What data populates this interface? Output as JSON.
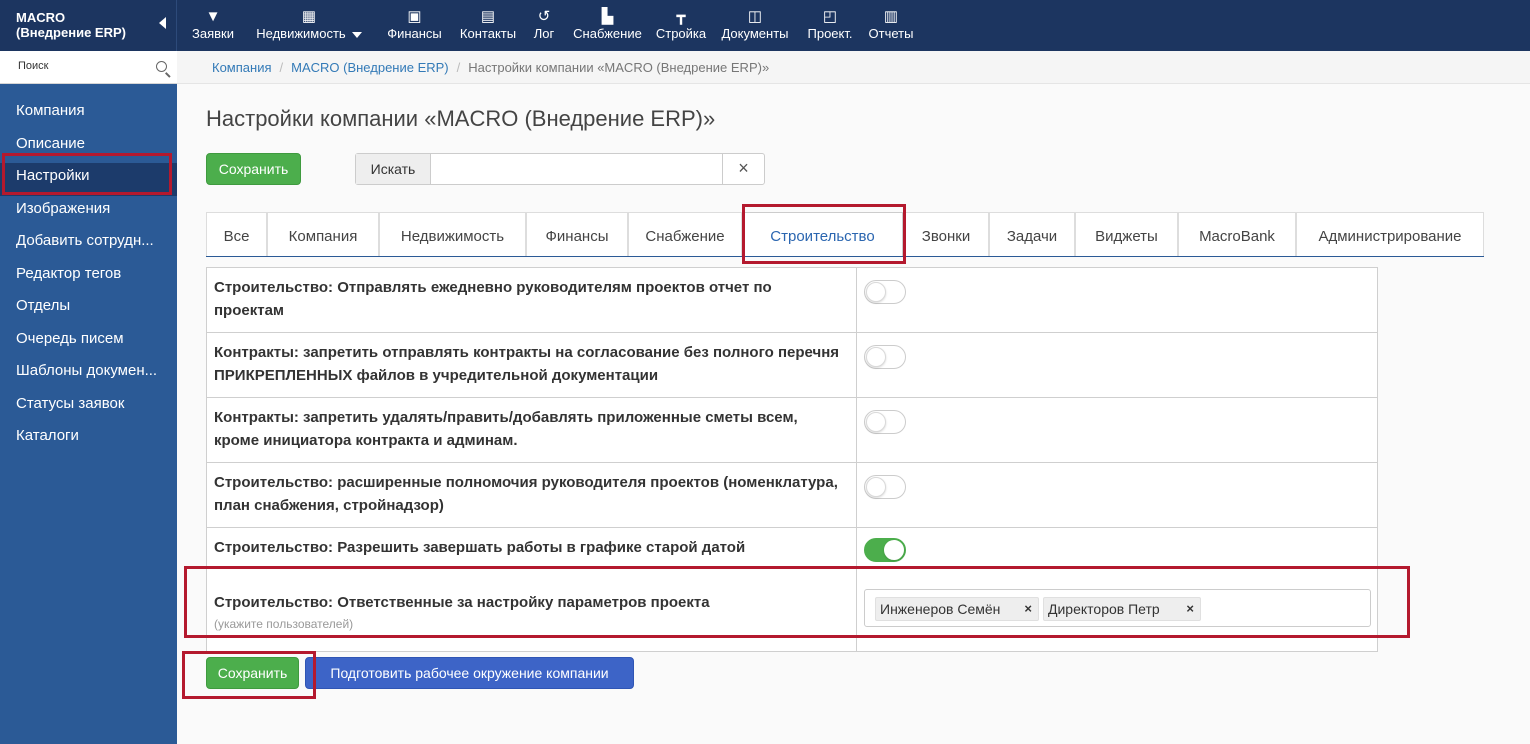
{
  "brand": {
    "line1": "MACRO",
    "line2": "(Внедрение ERP)"
  },
  "topnav": [
    {
      "label": "Заявки",
      "icon": "funnel-icon",
      "glyph": "▼"
    },
    {
      "label": "Недвижимость",
      "icon": "building-icon",
      "glyph": "▦"
    },
    {
      "label": "Финансы",
      "icon": "money-icon",
      "glyph": "▣"
    },
    {
      "label": "Контакты",
      "icon": "contact-card-icon",
      "glyph": "▤"
    },
    {
      "label": "Лог",
      "icon": "history-icon",
      "glyph": "↺"
    },
    {
      "label": "Снабжение",
      "icon": "truck-icon",
      "glyph": "▙"
    },
    {
      "label": "Стройка",
      "icon": "crane-icon",
      "glyph": "┳"
    },
    {
      "label": "Документы",
      "icon": "document-icon",
      "glyph": "◫"
    },
    {
      "label": "Проект.",
      "icon": "pdf-icon",
      "glyph": "◰"
    },
    {
      "label": "Отчеты",
      "icon": "bar-chart-icon",
      "glyph": "▥"
    }
  ],
  "sidebar": {
    "search_placeholder": "Поиск",
    "items": [
      "Компания",
      "Описание",
      "Настройки",
      "Изображения",
      "Добавить сотрудн...",
      "Редактор тегов",
      "Отделы",
      "Очередь писем",
      "Шаблоны докумен...",
      "Статусы заявок",
      "Каталоги"
    ],
    "active_index": 2
  },
  "breadcrumb": {
    "crumb1": "Компания",
    "crumb2": "MACRO (Внедрение ERP)",
    "current": "Настройки компании «MACRO (Внедрение ERP)»"
  },
  "page": {
    "title": "Настройки компании «MACRO (Внедрение ERP)»",
    "save_label": "Сохранить",
    "search_addon": "Искать",
    "search_value": "",
    "clear_glyph": "×",
    "prepare_label": "Подготовить рабочее окружение компании"
  },
  "tabs": [
    "Все",
    "Компания",
    "Недвижимость",
    "Финансы",
    "Снабжение",
    "Строительство",
    "Звонки",
    "Задачи",
    "Виджеты",
    "MacroBank",
    "Администрирование"
  ],
  "active_tab": "Строительство",
  "settings": [
    {
      "label": "Строительство: Отправлять ежедневно руководителям проектов отчет по проектам",
      "enabled": false
    },
    {
      "label": "Контракты: запретить отправлять контракты на согласование без полного перечня ПРИКРЕПЛЕННЫХ файлов в учредительной документации",
      "enabled": false
    },
    {
      "label": "Контракты: запретить удалять/править/добавлять приложенные сметы всем, кроме инициатора контракта и админам.",
      "enabled": false
    },
    {
      "label": "Строительство: расширенные полномочия руководителя проектов (номенклатура, план снабжения, стройнадзор)",
      "enabled": false
    },
    {
      "label": "Строительство: Разрешить завершать работы в графике старой датой",
      "enabled": true
    },
    {
      "label": "Строительство: Ответственные за настройку параметров проекта",
      "hint": "(укажите пользователей)",
      "users": [
        "Инженеров Семён",
        "Директоров Петр"
      ],
      "remove_glyph": "×"
    }
  ],
  "colors": {
    "topbar": "#1c3560",
    "sidebar": "#2b5a96",
    "accent_blue": "#2b66b0",
    "success": "#4cae4c",
    "primary": "#3d64c7",
    "annotation": "#b4192e"
  }
}
